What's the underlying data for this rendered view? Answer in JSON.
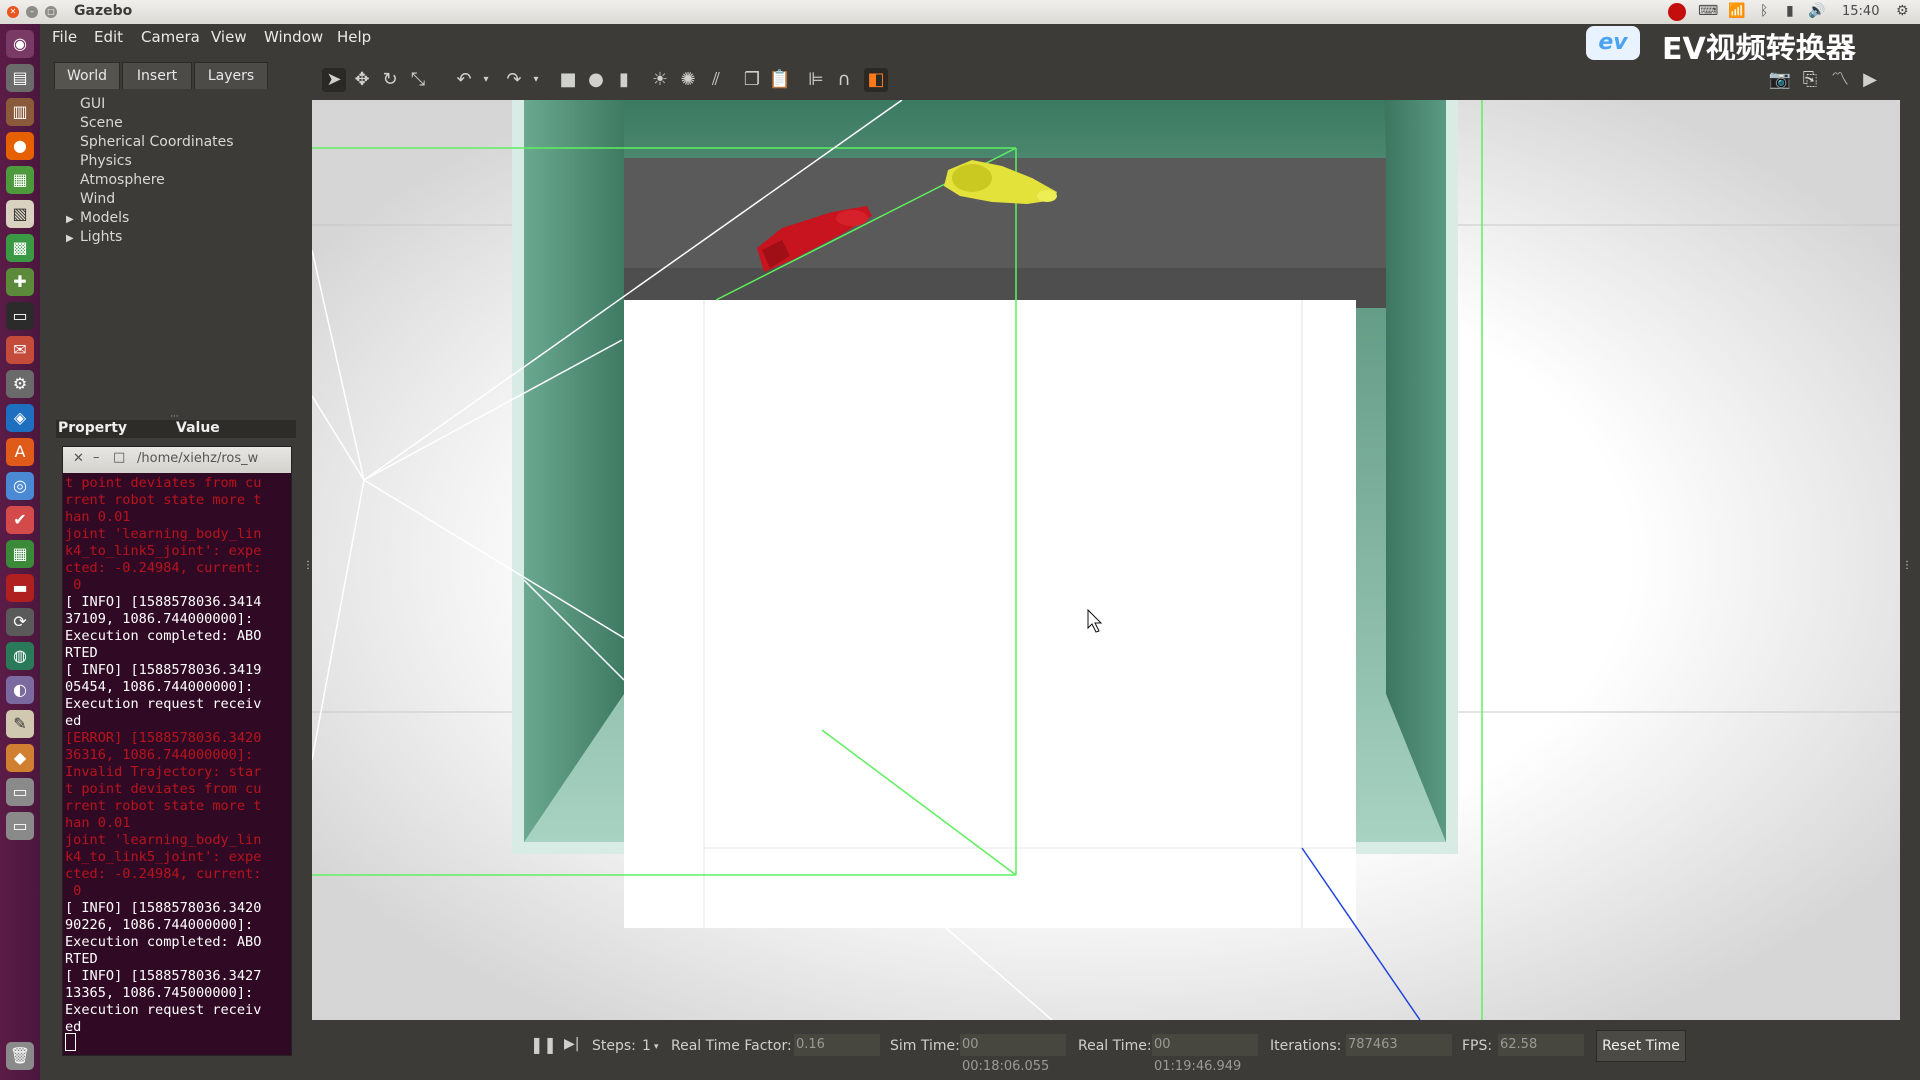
{
  "system": {
    "window_title": "Gazebo",
    "clock": "15:40"
  },
  "menus": [
    "File",
    "Edit",
    "Camera",
    "View",
    "Window",
    "Help"
  ],
  "overlay": {
    "logo_text": "ev",
    "brand_text": "EV视频转换器"
  },
  "tabs": [
    "World",
    "Insert",
    "Layers"
  ],
  "world_tree": [
    "GUI",
    "Scene",
    "Spherical Coordinates",
    "Physics",
    "Atmosphere",
    "Wind",
    "Models",
    "Lights"
  ],
  "property_panel": {
    "property_header": "Property",
    "value_header": "Value"
  },
  "terminal": {
    "title": "/home/xiehz/ros_w",
    "lines": [
      {
        "text": "t point deviates from cu",
        "err": true
      },
      {
        "text": "rrent robot state more t",
        "err": true
      },
      {
        "text": "han 0.01",
        "err": true
      },
      {
        "text": "joint 'learning_body_lin",
        "err": true
      },
      {
        "text": "k4_to_link5_joint': expe",
        "err": true
      },
      {
        "text": "cted: -0.24984, current:",
        "err": true
      },
      {
        "text": " 0",
        "err": true
      },
      {
        "text": "[ INFO] [1588578036.3414",
        "err": false
      },
      {
        "text": "37109, 1086.744000000]:",
        "err": false
      },
      {
        "text": "Execution completed: ABO",
        "err": false
      },
      {
        "text": "RTED",
        "err": false
      },
      {
        "text": "[ INFO] [1588578036.3419",
        "err": false
      },
      {
        "text": "05454, 1086.744000000]:",
        "err": false
      },
      {
        "text": "Execution request receiv",
        "err": false
      },
      {
        "text": "ed",
        "err": false
      },
      {
        "text": "[ERROR] [1588578036.3420",
        "err": true
      },
      {
        "text": "36316, 1086.744000000]:",
        "err": true
      },
      {
        "text": "Invalid Trajectory: star",
        "err": true
      },
      {
        "text": "t point deviates from cu",
        "err": true
      },
      {
        "text": "rrent robot state more t",
        "err": true
      },
      {
        "text": "han 0.01",
        "err": true
      },
      {
        "text": "joint 'learning_body_lin",
        "err": true
      },
      {
        "text": "k4_to_link5_joint': expe",
        "err": true
      },
      {
        "text": "cted: -0.24984, current:",
        "err": true
      },
      {
        "text": " 0",
        "err": true
      },
      {
        "text": "[ INFO] [1588578036.3420",
        "err": false
      },
      {
        "text": "90226, 1086.744000000]:",
        "err": false
      },
      {
        "text": "Execution completed: ABO",
        "err": false
      },
      {
        "text": "RTED",
        "err": false
      },
      {
        "text": "[ INFO] [1588578036.3427",
        "err": false
      },
      {
        "text": "13365, 1086.745000000]:",
        "err": false
      },
      {
        "text": "Execution request receiv",
        "err": false
      },
      {
        "text": "ed",
        "err": false
      }
    ]
  },
  "status": {
    "steps_label": "Steps:",
    "steps_value": "1",
    "rtf_label": "Real Time Factor:",
    "rtf_value": "0.16",
    "sim_time_label": "Sim Time:",
    "sim_time_value": "00 00:18:06.055",
    "real_time_label": "Real Time:",
    "real_time_value": "00 01:19:46.949",
    "iterations_label": "Iterations:",
    "iterations_value": "787463",
    "fps_label": "FPS:",
    "fps_value": "62.58",
    "reset_label": "Reset Time"
  },
  "colors": {
    "launcher": "#5b1c47",
    "panel": "#3c3b37",
    "terminal_bg": "#300a24",
    "wall_green": "#4c8a72",
    "robot_red": "#c8141e",
    "robot_yellow": "#e2e23a",
    "grid_green": "#5ef05e"
  }
}
